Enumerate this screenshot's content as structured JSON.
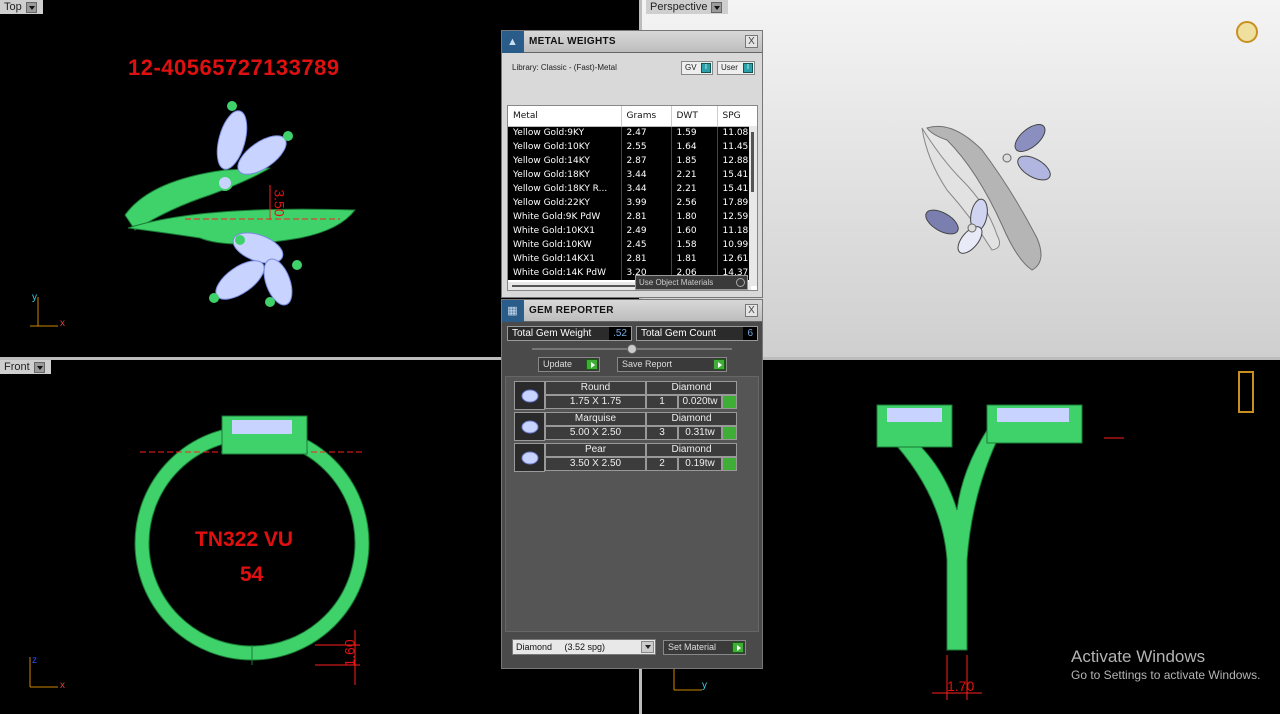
{
  "viewports": {
    "top": {
      "label": "Top",
      "serial": "12-40565727133789",
      "dimension": "3.50",
      "axis_y": "y",
      "axis_x": "x"
    },
    "perspective": {
      "label": "Perspective"
    },
    "front": {
      "label": "Front",
      "line1": "TN322 VU",
      "line2": "54",
      "dimension": "1.60",
      "axis_z": "z",
      "axis_x": "x"
    },
    "right": {
      "dimension": "1.70",
      "axis_y": "y"
    }
  },
  "metal_weights": {
    "title": "METAL WEIGHTS",
    "library": "Library: Classic - (Fast)-Metal",
    "gv_label": "GV",
    "user_label": "User",
    "toggle_glyph": "I",
    "columns": [
      "Metal",
      "Grams",
      "DWT",
      "SPG"
    ],
    "rows": [
      [
        "Yellow Gold:9KY",
        "2.47",
        "1.59",
        "11.08"
      ],
      [
        "Yellow Gold:10KY",
        "2.55",
        "1.64",
        "11.45"
      ],
      [
        "Yellow Gold:14KY",
        "2.87",
        "1.85",
        "12.88"
      ],
      [
        "Yellow Gold:18KY",
        "3.44",
        "2.21",
        "15.41"
      ],
      [
        "Yellow Gold:18KY R...",
        "3.44",
        "2.21",
        "15.41"
      ],
      [
        "Yellow Gold:22KY",
        "3.99",
        "2.56",
        "17.89"
      ],
      [
        "White Gold:9K PdW",
        "2.81",
        "1.80",
        "12.59"
      ],
      [
        "White Gold:10KX1",
        "2.49",
        "1.60",
        "11.18"
      ],
      [
        "White Gold:10KW",
        "2.45",
        "1.58",
        "10.99"
      ],
      [
        "White Gold:14KX1",
        "2.81",
        "1.81",
        "12.61"
      ],
      [
        "White Gold:14K PdW",
        "3.20",
        "2.06",
        "14.37"
      ]
    ],
    "use_object_materials": "Use Object Materials"
  },
  "gem_reporter": {
    "title": "GEM REPORTER",
    "total_weight_label": "Total Gem Weight",
    "total_weight_value": ".52",
    "total_count_label": "Total Gem Count",
    "total_count_value": "6",
    "update_label": "Update",
    "save_report_label": "Save Report",
    "gems": [
      {
        "shape": "Round",
        "material": "Diamond",
        "size": "1.75 X 1.75",
        "qty": "1",
        "weight": "0.020tw"
      },
      {
        "shape": "Marquise",
        "material": "Diamond",
        "size": "5.00 X 2.50",
        "qty": "3",
        "weight": "0.31tw"
      },
      {
        "shape": "Pear",
        "material": "Diamond",
        "size": "3.50 X 2.50",
        "qty": "2",
        "weight": "0.19tw"
      }
    ],
    "material_select": "Diamond     (3.52 spg)",
    "set_material_label": "Set Material",
    "close_glyph": "X"
  },
  "watermark": {
    "title": "Activate Windows",
    "subtitle": "Go to Settings to activate Windows."
  }
}
